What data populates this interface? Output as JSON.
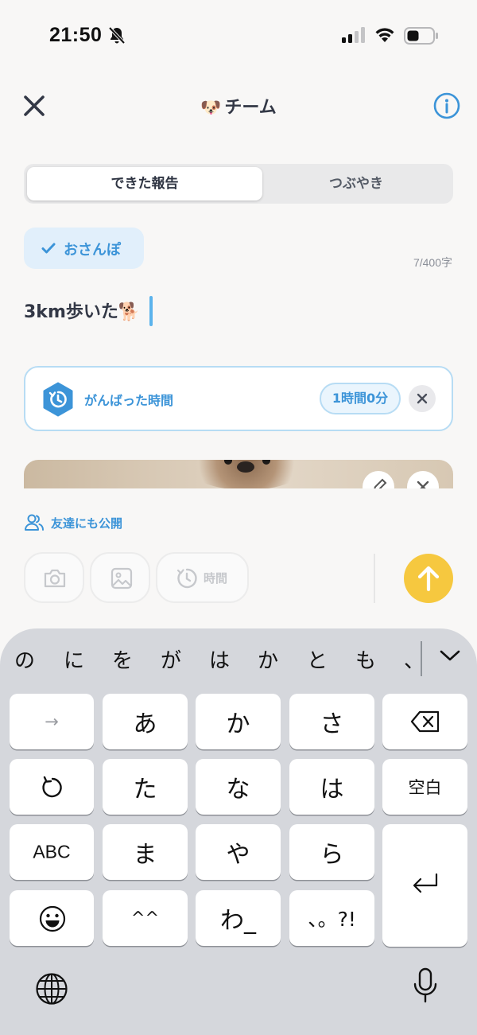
{
  "status_bar": {
    "time": "21:50"
  },
  "header": {
    "title": "チーム",
    "title_icon": "🐶"
  },
  "segments": [
    {
      "label": "できた報告",
      "active": true
    },
    {
      "label": "つぶやき",
      "active": false
    }
  ],
  "tag": {
    "label": "おさんぽ"
  },
  "char_counter": "7/400字",
  "post_text": "3km歩いた🐕",
  "time_card": {
    "label": "がんばった時間",
    "value": "1時間0分"
  },
  "visibility": {
    "label": "友達にも公開"
  },
  "actions": {
    "time_label": "時間"
  },
  "colors": {
    "accent": "#3c94d8",
    "send": "#f6c83f"
  },
  "keyboard": {
    "suggestions": [
      "の",
      "に",
      "を",
      "が",
      "は",
      "か",
      "と",
      "も",
      "、"
    ],
    "rows": [
      [
        "→",
        "あ",
        "か",
        "さ",
        "delete"
      ],
      [
        "undo",
        "た",
        "な",
        "は",
        "空白"
      ],
      [
        "ABC",
        "ま",
        "や",
        "ら",
        "return"
      ],
      [
        "emoji",
        "^^",
        "わ_",
        "、。?!"
      ]
    ]
  }
}
